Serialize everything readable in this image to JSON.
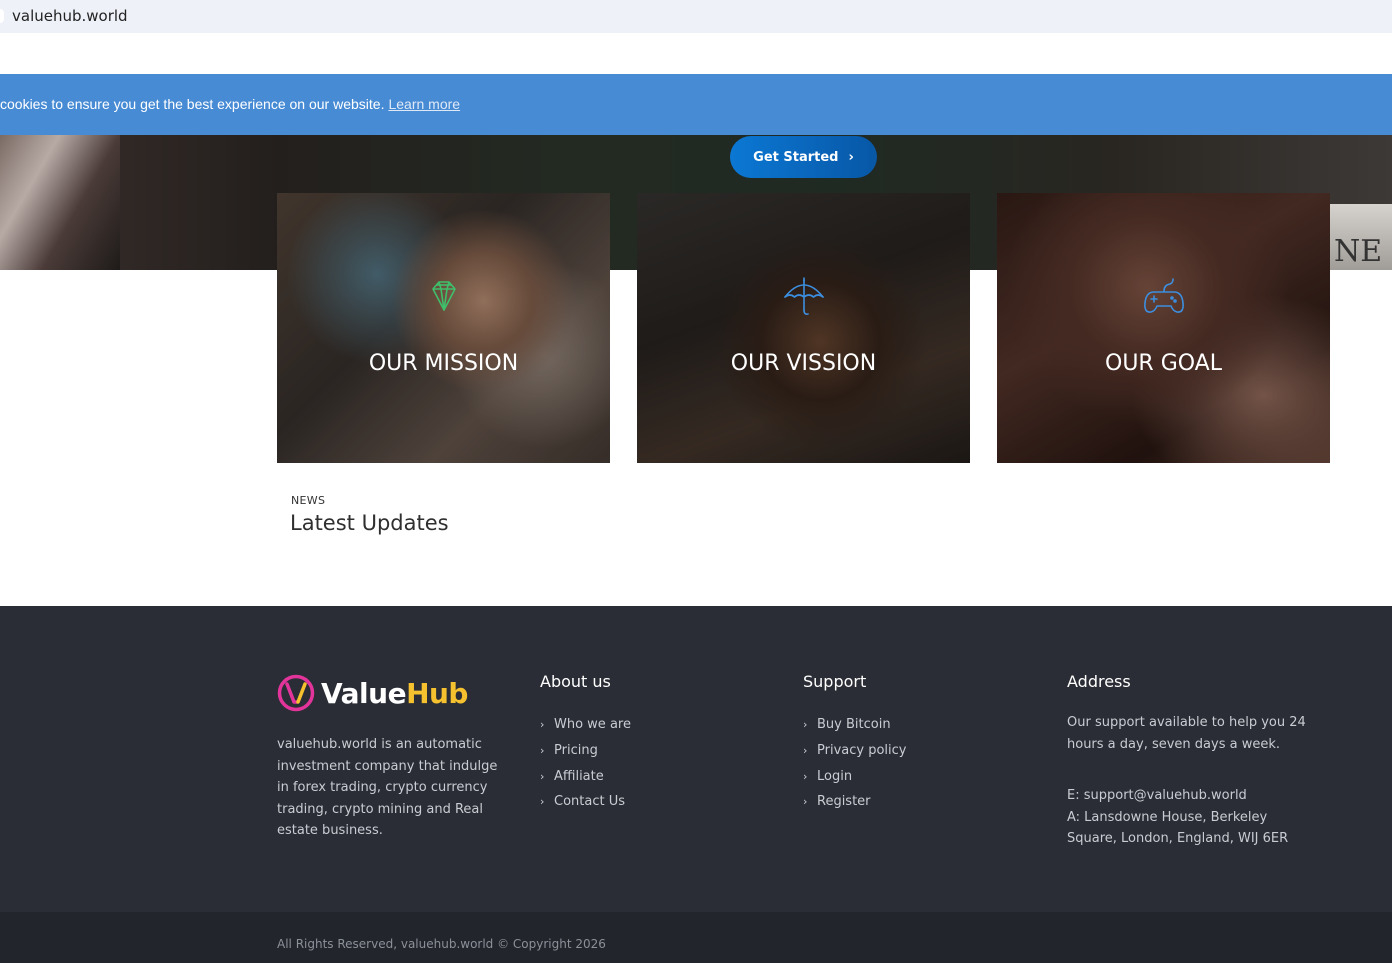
{
  "browser": {
    "url": "valuehub.world"
  },
  "cookie_bar": {
    "message": "cookies to ensure you get the best experience on our website.",
    "link": "Learn more"
  },
  "hero": {
    "cta_label": "Get Started",
    "right_fragment": "NE"
  },
  "cards": [
    {
      "title": "OUR MISSION",
      "icon": "diamond-icon",
      "icon_color": "#3fbf6a"
    },
    {
      "title": "OUR VISSION",
      "icon": "umbrella-icon",
      "icon_color": "#3c8fe0"
    },
    {
      "title": "OUR GOAL",
      "icon": "gamepad-icon",
      "icon_color": "#3c8fe0"
    }
  ],
  "news": {
    "kicker": "NEWS",
    "title": "Latest Updates"
  },
  "footer": {
    "logo": {
      "part1": "Value",
      "part2": "Hub",
      "brand_pink": "#e3349b",
      "brand_yellow": "#f6c12e"
    },
    "about_text": "valuehub.world is an automatic investment company that indulge in forex trading, crypto currency trading, crypto mining and Real estate business.",
    "about": {
      "heading": "About us",
      "links": [
        "Who we are",
        "Pricing",
        "Affiliate",
        "Contact Us"
      ]
    },
    "support": {
      "heading": "Support",
      "links": [
        "Buy Bitcoin",
        "Privacy policy",
        "Login",
        "Register"
      ]
    },
    "address": {
      "heading": "Address",
      "text": "Our support available to help you 24 hours a day, seven days a week.",
      "email": "E: support@valuehub.world",
      "location": "A: Lansdowne House, Berkeley Square, London, England, WIJ 6ER"
    },
    "copyright": "All Rights Reserved, valuehub.world © Copyright 2026"
  },
  "colors": {
    "cookie_bg": "#478bd5",
    "footer_bg": "#2a2d35",
    "cta_bg": "#0b78d4"
  }
}
